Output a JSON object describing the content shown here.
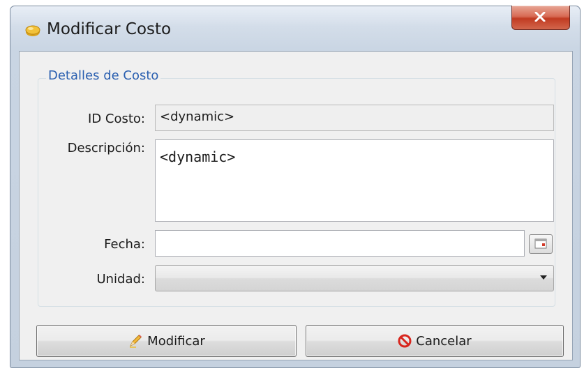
{
  "window": {
    "title": "Modificar Costo",
    "icons": {
      "app": "coin-icon",
      "close": "close-icon"
    }
  },
  "group": {
    "title": "Detalles de Costo"
  },
  "fields": {
    "id_costo": {
      "label": "ID Costo:",
      "value": "<dynamic>"
    },
    "descripcion": {
      "label": "Descripción:",
      "value": "<dynamic>"
    },
    "fecha": {
      "label": "Fecha:",
      "value": "",
      "icon": "calendar-icon"
    },
    "unidad": {
      "label": "Unidad:",
      "value": "",
      "icon": "chevron-down-icon"
    }
  },
  "buttons": {
    "modificar": {
      "label": "Modificar",
      "icon": "pencil-icon"
    },
    "cancelar": {
      "label": "Cancelar",
      "icon": "cancel-icon"
    }
  },
  "colors": {
    "group_title": "#2a5fb0",
    "close_button": "#c13b22",
    "cancel_icon": "#d8261e"
  }
}
